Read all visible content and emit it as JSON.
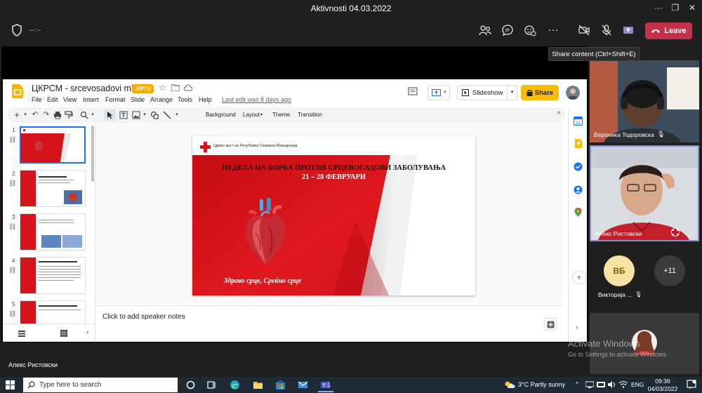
{
  "window": {
    "title": "Aktivnosti 04.03.2022"
  },
  "toolbar": {
    "timer": "--:--",
    "leave_label": "Leave",
    "tooltip": "Share content (Ctrl+Shift+E)"
  },
  "slides_app": {
    "doc_title": "ЦКРСМ - srcevosadovi mk",
    "file_badge": ".PPTX",
    "menus": [
      "File",
      "Edit",
      "View",
      "Insert",
      "Format",
      "Slide",
      "Arrange",
      "Tools",
      "Help"
    ],
    "last_edit": "Last edit was 8 days ago",
    "slideshow_label": "Slideshow",
    "share_label": "Share",
    "edit_toolbar": {
      "background": "Background",
      "layout": "Layout",
      "theme": "Theme",
      "transition": "Transition"
    },
    "thumb_numbers": [
      "1",
      "2",
      "3",
      "4",
      "5"
    ],
    "speaker_notes": "Click to add speaker notes",
    "slide": {
      "org": "Црвен крст на Република Северна Македонија",
      "title": "НЕДЕЛА НА БОРБА ПРОТИВ СРЦЕВОСАДОВИ ЗАБОЛУВАЊА",
      "dates": "21 – 28 ФЕВРУАРИ",
      "slogan": "Здраво срце, Среќно срце"
    }
  },
  "participants": {
    "p1_name": "Вероника Тодоровска",
    "p2_name": "Алекс Ристовски",
    "p3_initials": "ВБ",
    "p3_name": "Викторија ...",
    "more_count": "+11"
  },
  "presenter_label": "Алекс Ристовски",
  "watermark": {
    "line1": "Activate Windows",
    "line2": "Go to Settings to activate Windows."
  },
  "taskbar": {
    "search_placeholder": "Type here to search",
    "weather": "3°C  Partly sunny",
    "lang": "ENG",
    "time": "09:36",
    "date": "04/03/2022"
  },
  "colors": {
    "leave": "#c4314b",
    "accent_yellow": "#fbbc04",
    "slide_red": "#d4141a",
    "teams_bg": "#1f1f1f"
  }
}
